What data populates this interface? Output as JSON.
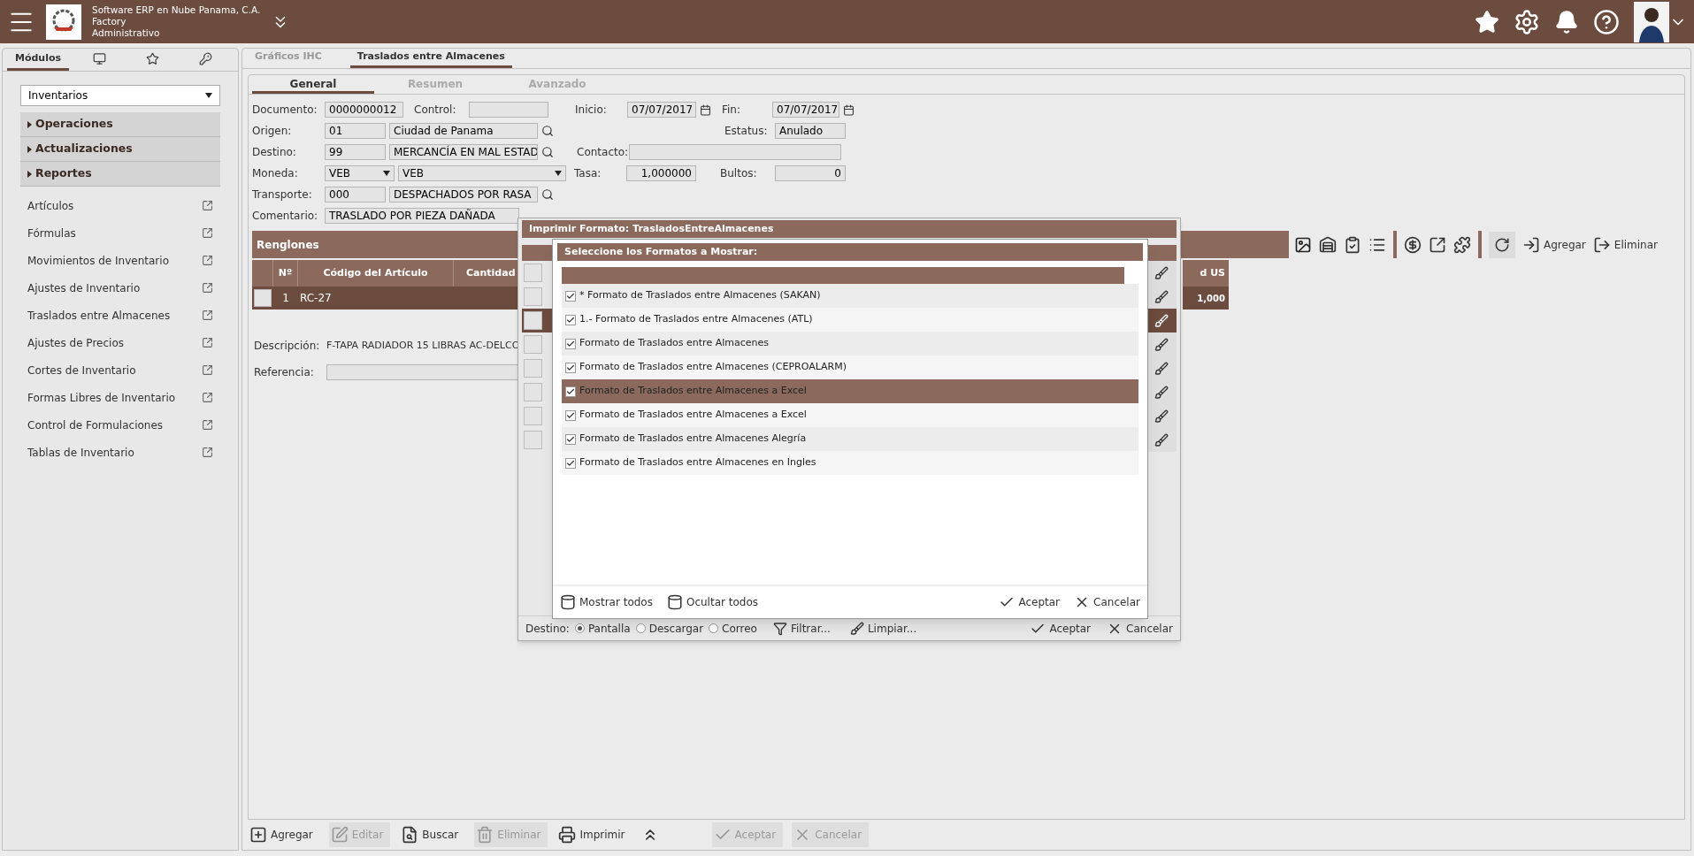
{
  "header": {
    "company": "Software ERP en Nube Panama, C.A.",
    "line_2": "Factory",
    "line_3": "Administrativo"
  },
  "sidebar": {
    "tabs": [
      {
        "kind": "text",
        "label": "Módulos",
        "selected": true
      },
      {
        "kind": "monitor",
        "selected": false
      },
      {
        "kind": "star",
        "selected": false
      },
      {
        "kind": "key",
        "selected": false
      }
    ],
    "module": "Inventarios",
    "sections": [
      {
        "label": "Operaciones",
        "expanded": false
      },
      {
        "label": "Actualizaciones",
        "expanded": false
      },
      {
        "label": "Reportes",
        "expanded": false
      }
    ],
    "items": [
      {
        "label": "Artículos"
      },
      {
        "label": "Fórmulas"
      },
      {
        "label": "Movimientos de Inventario"
      },
      {
        "label": "Ajustes de Inventario"
      },
      {
        "label": "Traslados entre Almacenes"
      },
      {
        "label": "Ajustes de Precios"
      },
      {
        "label": "Cortes de Inventario"
      },
      {
        "label": "Formas Libres de Inventario"
      },
      {
        "label": "Control de Formulaciones"
      },
      {
        "label": "Tablas de Inventario"
      }
    ]
  },
  "tabs": [
    {
      "label": "Gráficos IHC",
      "selected": false
    },
    {
      "label": "Traslados entre Almacenes",
      "selected": true
    }
  ],
  "subtabs": [
    {
      "label": "General",
      "selected": true
    },
    {
      "label": "Resumen",
      "selected": false
    },
    {
      "label": "Avanzado",
      "selected": false
    }
  ],
  "form": {
    "documento": {
      "label": "Documento:",
      "value": "0000000012"
    },
    "control": {
      "label": "Control:"
    },
    "inicio": {
      "label": "Inicio:",
      "value": "07/07/2017"
    },
    "fin": {
      "label": "Fin:",
      "value": "07/07/2017"
    },
    "origen": {
      "label": "Origen:",
      "code": "01",
      "name": "Ciudad de Panama"
    },
    "estatus": {
      "label": "Estatus:",
      "value": "Anulado"
    },
    "destino": {
      "label": "Destino:",
      "code": "99",
      "name": "MERCANCÍA EN MAL ESTAD"
    },
    "contacto": {
      "label": "Contacto:"
    },
    "moneda": {
      "label": "Moneda:",
      "code": "VEB",
      "name": "VEB"
    },
    "tasa": {
      "label": "Tasa:",
      "value": "1,000000"
    },
    "bultos": {
      "label": "Bultos:",
      "value": "0"
    },
    "transporte": {
      "label": "Transporte:",
      "code": "000",
      "name": "DESPACHADOS POR RASA"
    },
    "comentario": {
      "label": "Comentario:",
      "value": "TRASLADO POR PIEZA DAÑADA"
    }
  },
  "lines": {
    "title": "Renglones",
    "columns": [
      "Nº",
      "Código del Artículo",
      "Cantidad"
    ],
    "column_4": "d US",
    "rows": [
      {
        "number": "1",
        "code": "RC-27",
        "column_4": "1,000",
        "selected": true
      }
    ]
  },
  "description": {
    "label": "Descripción:",
    "value": "F-TAPA RADIADOR 15 LIBRAS AC-DELCO"
  },
  "reference": {
    "label": "Referencia:"
  },
  "toolbar": {
    "add": "Agregar",
    "remove": "Eliminar"
  },
  "actions": [
    {
      "kind": "add",
      "label": "Agregar",
      "disabled": false
    },
    {
      "kind": "edit",
      "label": "Editar",
      "disabled": true
    },
    {
      "kind": "search",
      "label": "Buscar",
      "disabled": false
    },
    {
      "kind": "delete",
      "label": "Eliminar",
      "disabled": true
    },
    {
      "kind": "print",
      "label": "Imprimir",
      "disabled": false
    },
    {
      "kind": "accept",
      "label": "Aceptar",
      "disabled": true
    },
    {
      "kind": "cancel",
      "label": "Cancelar",
      "disabled": true
    }
  ],
  "print_dialog": {
    "title": "Imprimir Formato: TrasladosEntreAlmacenes",
    "grid_rows": [
      {
        "selected": false
      },
      {
        "selected": false
      },
      {
        "selected": true
      },
      {
        "selected": false
      },
      {
        "selected": false
      },
      {
        "selected": false
      },
      {
        "selected": false
      },
      {
        "selected": false
      }
    ],
    "destination_label": "Destino:",
    "destinations": [
      {
        "label": "Pantalla",
        "selected": true
      },
      {
        "label": "Descargar",
        "selected": false
      },
      {
        "label": "Correo",
        "selected": false
      }
    ],
    "filter": "Filtrar...",
    "clear": "Limpiar...",
    "accept": "Aceptar",
    "cancel": "Cancelar",
    "formats_dialog": {
      "title": "Seleccione los Formatos a Mostrar:",
      "formats": [
        {
          "label": "* Formato de Traslados entre Almacenes (SAKAN)",
          "checked": true,
          "selected": false
        },
        {
          "label": "1.- Formato de Traslados entre Almacenes (ATL)",
          "checked": true,
          "selected": false
        },
        {
          "label": "Formato de Traslados entre Almacenes",
          "checked": true,
          "selected": false
        },
        {
          "label": "Formato de Traslados entre Almacenes (CEPROALARM)",
          "checked": true,
          "selected": false
        },
        {
          "label": "Formato de Traslados entre Almacenes a Excel",
          "checked": true,
          "selected": true
        },
        {
          "label": "Formato de Traslados entre Almacenes a Excel",
          "checked": true,
          "selected": false
        },
        {
          "label": "Formato de Traslados entre Almacenes Alegría",
          "checked": true,
          "selected": false
        },
        {
          "label": "Formato de Traslados entre Almacenes en Ingles",
          "checked": true,
          "selected": false
        }
      ],
      "show_all": "Mostrar todos",
      "hide_all": "Ocultar todos",
      "accept": "Aceptar",
      "cancel": "Cancelar"
    }
  }
}
